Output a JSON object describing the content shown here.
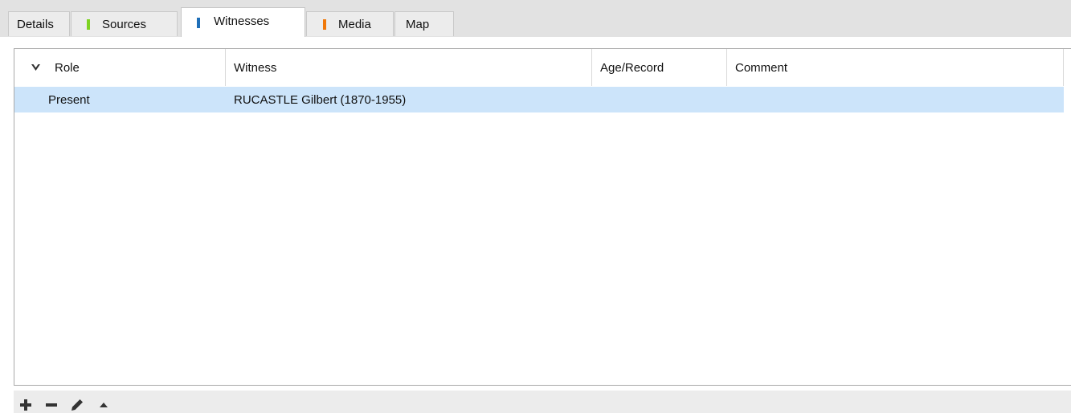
{
  "tabs": [
    {
      "label": "Details",
      "marker_color": null,
      "active": false
    },
    {
      "label": "Sources",
      "marker_color": "#7ed321",
      "active": false
    },
    {
      "label": "Witnesses",
      "marker_color": "#1f6fb8",
      "active": true
    },
    {
      "label": "Media",
      "marker_color": "#f0780a",
      "active": false
    },
    {
      "label": "Map",
      "marker_color": null,
      "active": false
    }
  ],
  "table": {
    "columns": [
      "Role",
      "Witness",
      "Age/Record",
      "Comment"
    ],
    "sort_icon": "chevron-down-icon",
    "rows": [
      {
        "role": "Present",
        "witness": "RUCASTLE Gilbert (1870-1955)",
        "age_record": "",
        "comment": "",
        "selected": true
      }
    ]
  },
  "toolbar": {
    "buttons": [
      {
        "name": "add-button",
        "icon": "plus-icon"
      },
      {
        "name": "remove-button",
        "icon": "minus-icon"
      },
      {
        "name": "edit-button",
        "icon": "pencil-icon"
      },
      {
        "name": "move-up-button",
        "icon": "triangle-up-icon"
      }
    ]
  },
  "colors": {
    "selection": "#cce4fa",
    "tabbar_bg": "#e2e2e2",
    "toolbar_icon": "#333333"
  }
}
